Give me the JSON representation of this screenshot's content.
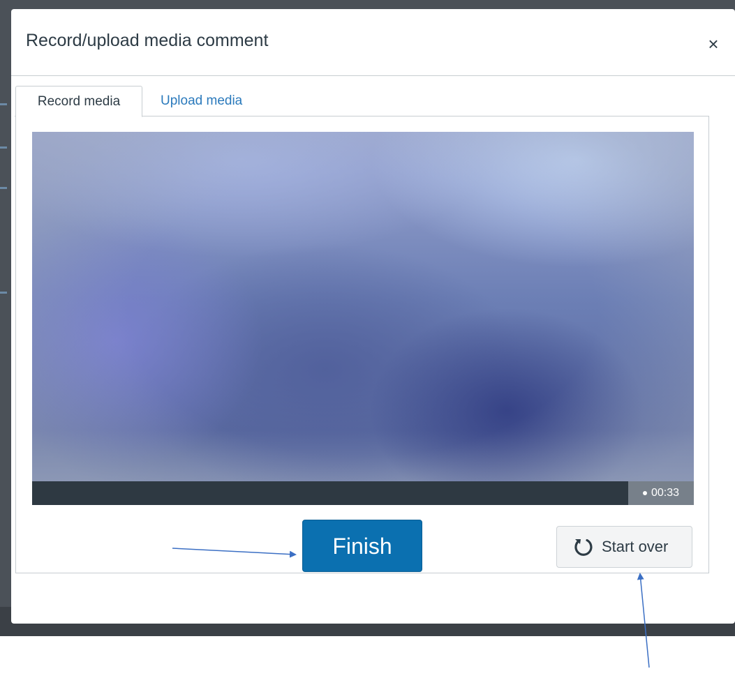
{
  "modal": {
    "title": "Record/upload media comment",
    "close_icon": "×"
  },
  "tabs": [
    {
      "label": "Record media",
      "active": true
    },
    {
      "label": "Upload media",
      "active": false
    }
  ],
  "recorder": {
    "elapsed": "00:33",
    "finish_label": "Finish",
    "start_over_label": "Start over",
    "start_over_icon": "refresh-icon"
  },
  "colors": {
    "primary_button": "#0b70b0",
    "link": "#2b7abc",
    "annotation_arrow": "#3b6fc4"
  }
}
